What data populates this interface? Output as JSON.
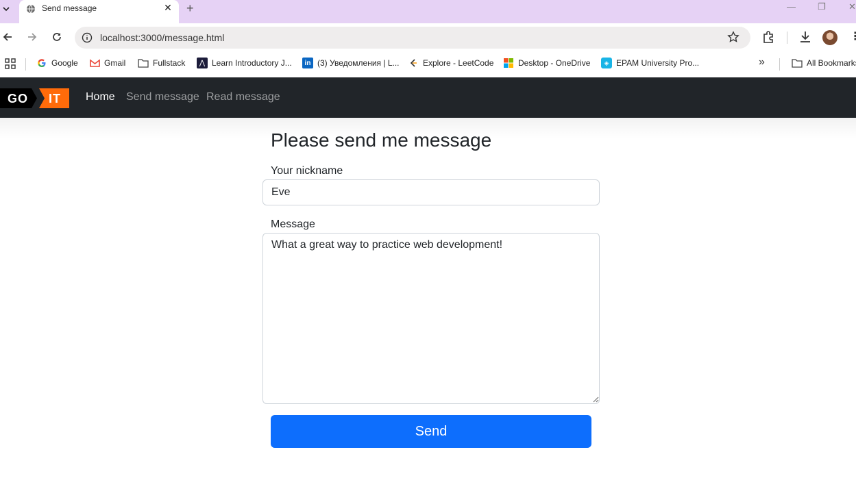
{
  "browser": {
    "tab_title": "Send message",
    "url": "localhost:3000/message.html",
    "bookmarks": [
      {
        "label": "Google",
        "icon": "google-icon"
      },
      {
        "label": "Gmail",
        "icon": "gmail-icon"
      },
      {
        "label": "Fullstack",
        "icon": "folder-icon"
      },
      {
        "label": "Learn Introductory J...",
        "icon": "learn-site-icon"
      },
      {
        "label": "(3) Уведомления | L...",
        "icon": "linkedin-icon"
      },
      {
        "label": "Explore - LeetCode",
        "icon": "leetcode-icon"
      },
      {
        "label": "Desktop - OneDrive",
        "icon": "microsoft-icon"
      },
      {
        "label": "EPAM University Pro...",
        "icon": "epam-icon"
      }
    ],
    "overflow_label": "»",
    "all_bookmarks": "All Bookmarks",
    "colors": {
      "tabstrip": "#e6d2f5"
    }
  },
  "page": {
    "logo": {
      "left": "GO",
      "right": "IT"
    },
    "nav": [
      {
        "label": "Home",
        "active": true
      },
      {
        "label": "Send message",
        "active": false
      },
      {
        "label": "Read message",
        "active": false
      }
    ],
    "form": {
      "title": "Please send me message",
      "nickname_label": "Your nickname",
      "nickname_value": "Eve",
      "message_label": "Message",
      "message_value": "What a great way to practice web development!",
      "submit_label": "Send"
    },
    "colors": {
      "navbar": "#212529",
      "primary": "#0d6efd",
      "logo_accent": "#ff6b0a"
    }
  }
}
